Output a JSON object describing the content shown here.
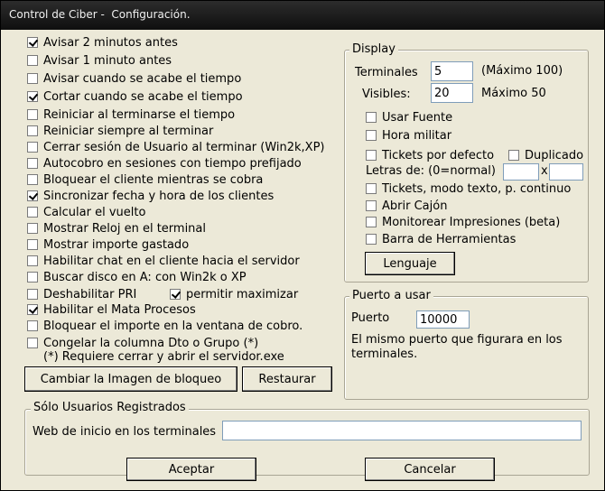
{
  "window": {
    "title": "Control de Ciber -  Configuración."
  },
  "options": [
    {
      "label": "Avisar 2 minutos antes",
      "checked": true
    },
    {
      "label": "Avisar 1 minuto antes",
      "checked": false
    },
    {
      "label": "Avisar cuando se acabe el tiempo",
      "checked": false
    },
    {
      "label": "Cortar cuando se acabe el tiempo",
      "checked": true
    },
    {
      "label": "Reiniciar al terminarse el tiempo",
      "checked": false
    },
    {
      "label": "Reiniciar siempre al terminar",
      "checked": false
    },
    {
      "label": "Cerrar sesión de Usuario al terminar (Win2k,XP)",
      "checked": false
    },
    {
      "label": "Autocobro en sesiones con tiempo prefijado",
      "checked": false
    },
    {
      "label": "Bloquear el cliente mientras se cobra",
      "checked": false
    },
    {
      "label": "Sincronizar fecha y hora de los clientes",
      "checked": true
    },
    {
      "label": "Calcular el vuelto",
      "checked": false
    },
    {
      "label": "Mostrar Reloj en el terminal",
      "checked": false
    },
    {
      "label": "Mostrar importe gastado",
      "checked": false
    },
    {
      "label": "Habilitar chat en el cliente hacia el servidor",
      "checked": false
    },
    {
      "label": "Buscar disco en A: con Win2k o XP",
      "checked": false
    },
    {
      "label": "Deshabilitar PRI",
      "checked": false
    },
    {
      "label": "Habilitar el Mata Procesos",
      "checked": true
    },
    {
      "label": "Bloquear el importe en la ventana de cobro.",
      "checked": false
    },
    {
      "label": "Congelar la columna Dto o Grupo (*)",
      "checked": false
    }
  ],
  "permitir_maximizar": {
    "label": "permitir maximizar",
    "checked": true
  },
  "note": "(*) Requiere cerrar y abrir el servidor.exe",
  "buttons": {
    "cambiar": "Cambiar la Imagen de bloqueo",
    "restaurar": "Restaurar",
    "lenguaje": "Lenguaje",
    "aceptar": "Aceptar",
    "cancelar": "Cancelar"
  },
  "display": {
    "title": "Display",
    "terminales_label": "Terminales",
    "terminales_value": "5",
    "terminales_hint": "(Máximo 100)",
    "visibles_label": "Visibles:",
    "visibles_value": "20",
    "visibles_hint": "Máximo 50",
    "checks": [
      {
        "label": "Usar Fuente",
        "checked": false
      },
      {
        "label": "Hora militar",
        "checked": false
      },
      {
        "label": "Tickets por defecto",
        "checked": false
      }
    ],
    "duplicado": {
      "label": "Duplicado",
      "checked": false
    },
    "letras_label": "Letras de: (0=normal)",
    "letras_x": "x",
    "letras_value1": "",
    "letras_value2": "",
    "checks2": [
      {
        "label": "Tickets, modo texto, p. continuo",
        "checked": false
      },
      {
        "label": "Abrir Cajón",
        "checked": false
      },
      {
        "label": "Monitorear Impresiones (beta)",
        "checked": false
      },
      {
        "label": "Barra de Herramientas",
        "checked": false
      }
    ]
  },
  "puerto": {
    "title": "Puerto a usar",
    "label": "Puerto",
    "value": "10000",
    "note_line1": "El mismo puerto que figurara en los",
    "note_line2": "terminales."
  },
  "registrados": {
    "title": "Sólo Usuarios Registrados",
    "web_label": "Web de inicio en los terminales",
    "web_value": ""
  }
}
